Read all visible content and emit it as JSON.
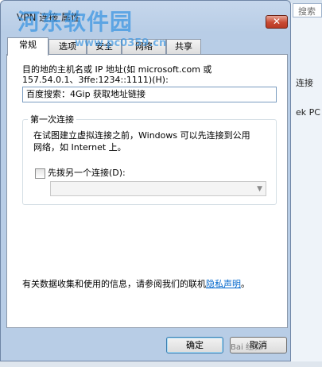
{
  "background_window": {
    "search_placeholder": "搜索",
    "text1": "连接",
    "text2": "ek PC"
  },
  "dialog": {
    "title": "VPN 连接 属性",
    "close_label": "✕",
    "watermark": "河东软件园",
    "watermark_url": "www.pc0359.cn",
    "tabs": [
      {
        "label": "常规",
        "active": true
      },
      {
        "label": "选项",
        "active": false
      },
      {
        "label": "安全",
        "active": false
      },
      {
        "label": "网络",
        "active": false
      },
      {
        "label": "共享",
        "active": false
      }
    ],
    "dest_label_line1": "目的地的主机名或 IP 地址(如 microsoft.com 或",
    "dest_label_line2": "157.54.0.1、3ffe:1234::1111)(H):",
    "host_value": "百度搜索：4Gip   获取地址链接",
    "first_connect": {
      "title": "第一次连接",
      "desc_line1": "在试图建立虚拟连接之前，Windows 可以先连接到公用",
      "desc_line2": "网络，如 Internet 上。",
      "checkbox_label": "先拨另一个连接(D):",
      "checkbox_checked": false,
      "select_value": ""
    },
    "privacy_text": "有关数据收集和使用的信息，请参阅我们的联机",
    "privacy_link": "隐私声明",
    "privacy_suffix": "。",
    "ok_label": "确定",
    "cancel_label": "取消",
    "corner_mark": "Bai 经验"
  }
}
